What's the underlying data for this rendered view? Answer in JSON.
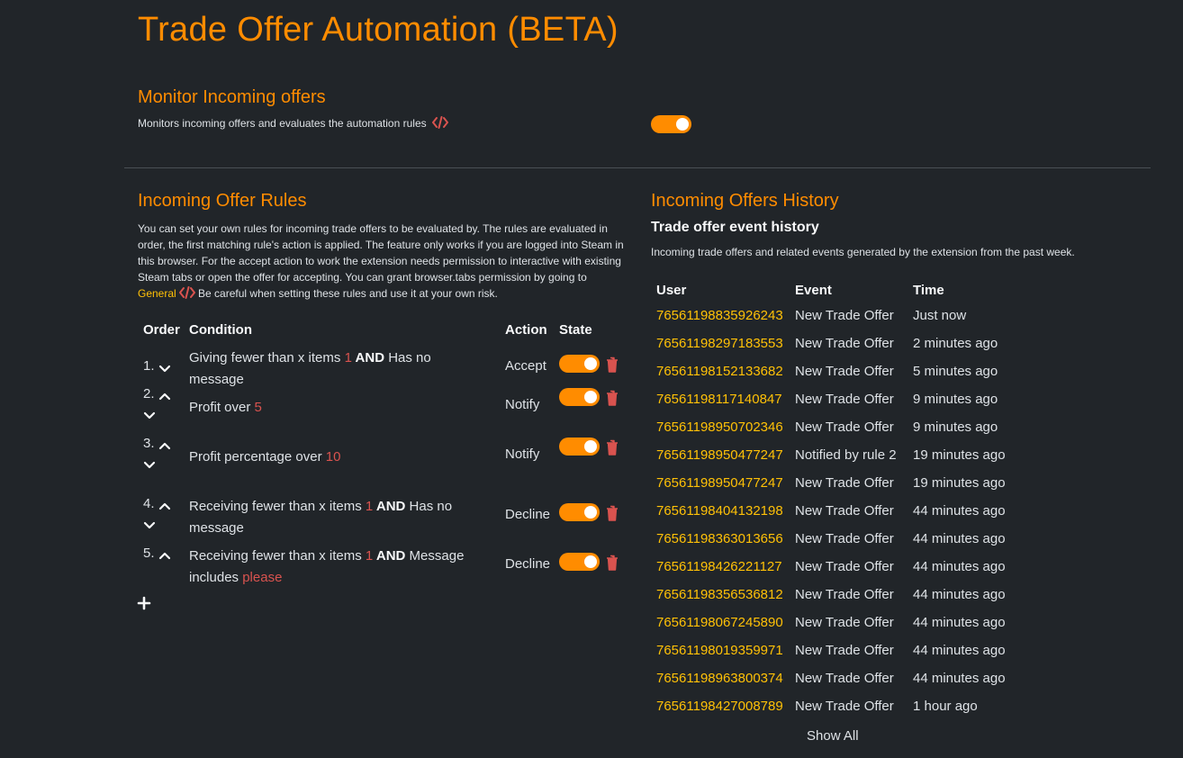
{
  "title": "Trade Offer Automation (BETA)",
  "monitor": {
    "heading": "Monitor Incoming offers",
    "description": "Monitors incoming offers and evaluates the automation rules",
    "enabled": true
  },
  "rules": {
    "heading": "Incoming Offer Rules",
    "desc_part1": "You can set your own rules for incoming trade offers to be evaluated by. The rules are evaluated in order, the first matching rule's action is applied. The feature only works if you are logged into Steam in this browser. For the accept action to work the extension needs permission to interactive with existing Steam tabs or open the offer for accepting. You can grant browser.tabs permission by going to ",
    "desc_link": "General",
    "desc_part2": " Be careful when setting these rules and use it at your own risk.",
    "columns": {
      "order": "Order",
      "condition": "Condition",
      "action": "Action",
      "state": "State"
    },
    "items": [
      {
        "num": "1.",
        "cond_a": "Giving fewer than x items ",
        "val_a": "1",
        "and": " AND",
        "cond_b": " Has no message",
        "val_b": "",
        "action": "Accept",
        "up": false,
        "down": true
      },
      {
        "num": "2.",
        "cond_a": "Profit over ",
        "val_a": "5",
        "and": "",
        "cond_b": "",
        "val_b": "",
        "action": "Notify",
        "up": true,
        "down": true
      },
      {
        "num": "3.",
        "cond_a": "Profit percentage over ",
        "val_a": "10",
        "and": "",
        "cond_b": "",
        "val_b": "",
        "action": "Notify",
        "up": true,
        "down": true
      },
      {
        "num": "4.",
        "cond_a": "Receiving fewer than x items ",
        "val_a": "1",
        "and": " AND",
        "cond_b": " Has no message",
        "val_b": "",
        "action": "Decline",
        "up": true,
        "down": true
      },
      {
        "num": "5.",
        "cond_a": "Receiving fewer than x items ",
        "val_a": "1",
        "and": " AND",
        "cond_b": " Message includes ",
        "val_b": "please",
        "action": "Decline",
        "up": true,
        "down": false
      }
    ]
  },
  "history": {
    "heading": "Incoming Offers History",
    "subheading": "Trade offer event history",
    "description": "Incoming trade offers and related events generated by the extension from the past week.",
    "columns": {
      "user": "User",
      "event": "Event",
      "time": "Time"
    },
    "rows": [
      {
        "user": "76561198835926243",
        "event": "New Trade Offer",
        "time": "Just now"
      },
      {
        "user": "76561198297183553",
        "event": "New Trade Offer",
        "time": "2 minutes ago"
      },
      {
        "user": "76561198152133682",
        "event": "New Trade Offer",
        "time": "5 minutes ago"
      },
      {
        "user": "76561198117140847",
        "event": "New Trade Offer",
        "time": "9 minutes ago"
      },
      {
        "user": "76561198950702346",
        "event": "New Trade Offer",
        "time": "9 minutes ago"
      },
      {
        "user": "76561198950477247",
        "event": "Notified by rule 2",
        "time": "19 minutes ago"
      },
      {
        "user": "76561198950477247",
        "event": "New Trade Offer",
        "time": "19 minutes ago"
      },
      {
        "user": "76561198404132198",
        "event": "New Trade Offer",
        "time": "44 minutes ago"
      },
      {
        "user": "76561198363013656",
        "event": "New Trade Offer",
        "time": "44 minutes ago"
      },
      {
        "user": "76561198426221127",
        "event": "New Trade Offer",
        "time": "44 minutes ago"
      },
      {
        "user": "76561198356536812",
        "event": "New Trade Offer",
        "time": "44 minutes ago"
      },
      {
        "user": "76561198067245890",
        "event": "New Trade Offer",
        "time": "44 minutes ago"
      },
      {
        "user": "76561198019359971",
        "event": "New Trade Offer",
        "time": "44 minutes ago"
      },
      {
        "user": "76561198963800374",
        "event": "New Trade Offer",
        "time": "44 minutes ago"
      },
      {
        "user": "76561198427008789",
        "event": "New Trade Offer",
        "time": "1 hour ago"
      }
    ],
    "show_all": "Show All"
  },
  "colors": {
    "accent": "#ff8c00",
    "link": "#ffc107",
    "danger": "#d9534f",
    "background": "#212529"
  },
  "icons": {
    "code": "code-icon",
    "up": "chevron-up-icon",
    "down": "chevron-down-icon",
    "trash": "trash-icon",
    "add": "plus-icon"
  }
}
